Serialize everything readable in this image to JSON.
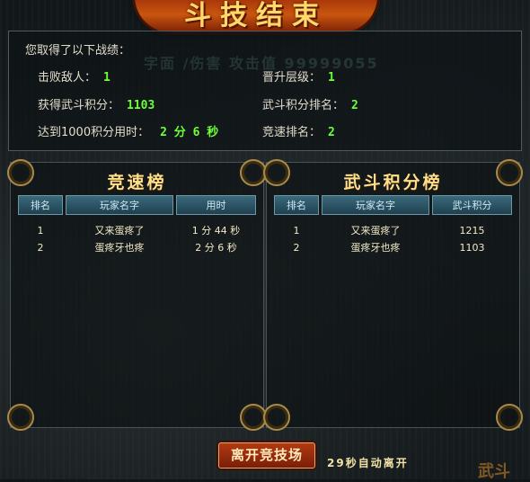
{
  "title": "斗技结束",
  "watermark": "字面 /伤害 攻击值 99999055",
  "results": {
    "intro": "您取得了以下战绩：",
    "defeated_label": "击败敌人：",
    "defeated_value": "1",
    "level_label": "晋升层级：",
    "level_value": "1",
    "points_label": "获得武斗积分：",
    "points_value": "1103",
    "points_rank_label": "武斗积分排名：",
    "points_rank_value": "2",
    "time_label": "达到1000积分用时：",
    "time_value": "2 分 6 秒",
    "speed_rank_label": "竞速排名：",
    "speed_rank_value": "2"
  },
  "speed_board": {
    "title": "竞速榜",
    "headers": [
      "排名",
      "玩家名字",
      "用时"
    ],
    "rows": [
      [
        "1",
        "又来蛋疼了",
        "1 分 44 秒"
      ],
      [
        "2",
        "蛋疼牙也疼",
        "2 分 6 秒"
      ]
    ]
  },
  "points_board": {
    "title": "武斗积分榜",
    "headers": [
      "排名",
      "玩家名字",
      "武斗积分"
    ],
    "rows": [
      [
        "1",
        "又来蛋疼了",
        "1215"
      ],
      [
        "2",
        "蛋疼牙也疼",
        "1103"
      ]
    ]
  },
  "leave_button": "离开竞技场",
  "countdown": "29秒自动离开",
  "corner_deco": "武斗",
  "colors": {
    "accent_value": "#6cff3a",
    "title_gold": "#ffdf8c",
    "button_red": "#b23a12",
    "header_teal": "#2d5b6c"
  }
}
